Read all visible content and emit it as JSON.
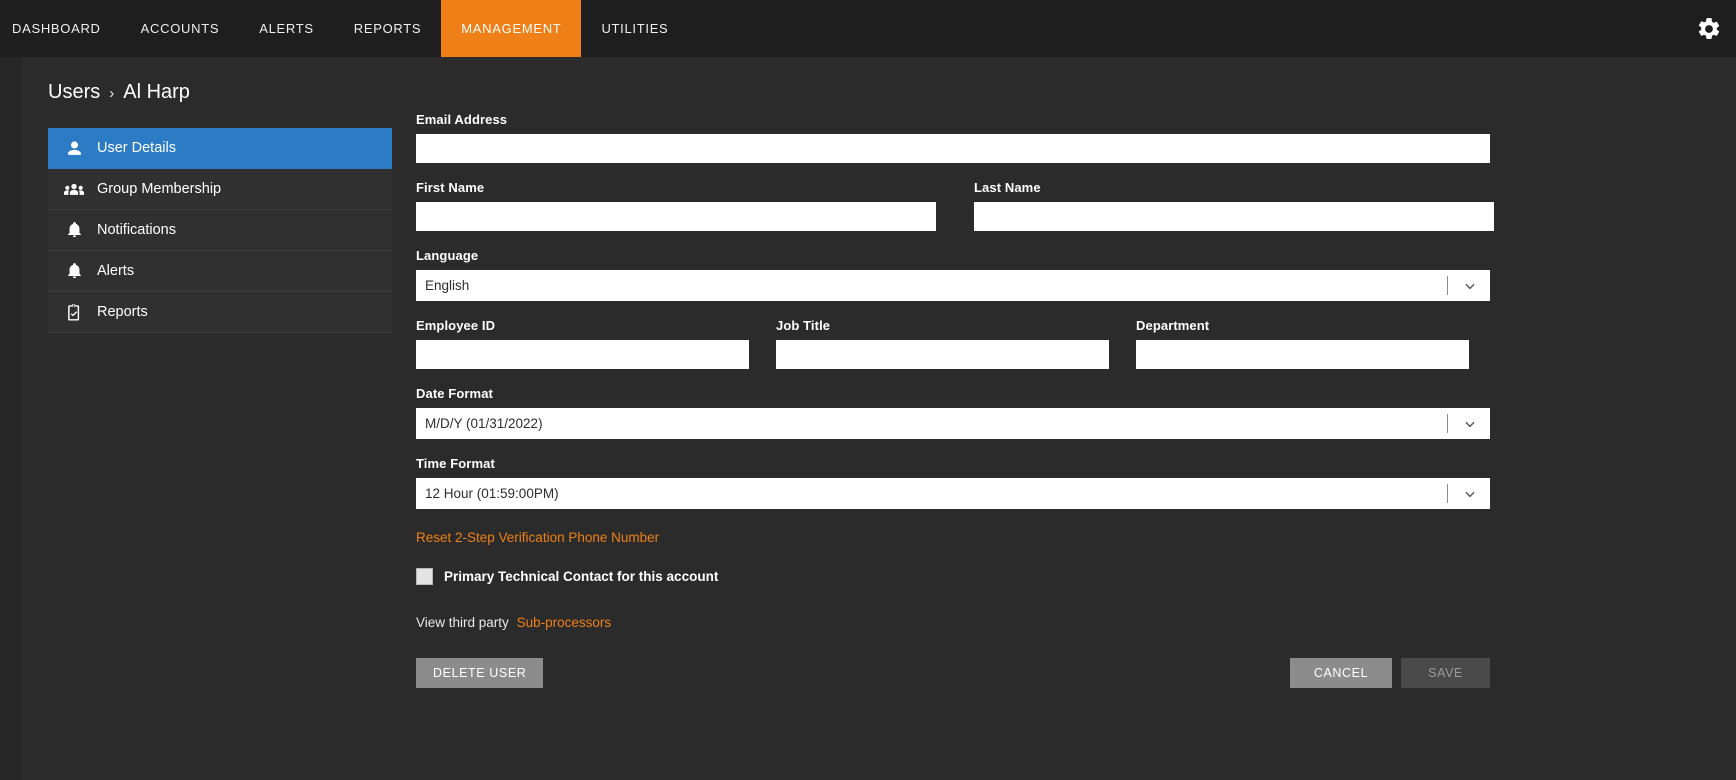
{
  "topnav": {
    "items": [
      {
        "label": "DASHBOARD",
        "active": false
      },
      {
        "label": "ACCOUNTS",
        "active": false
      },
      {
        "label": "ALERTS",
        "active": false
      },
      {
        "label": "REPORTS",
        "active": false
      },
      {
        "label": "MANAGEMENT",
        "active": true
      },
      {
        "label": "UTILITIES",
        "active": false
      }
    ],
    "settings_icon": "gear-icon",
    "accent_color": "#ef8017",
    "background_color": "#1e1e1e"
  },
  "breadcrumb": {
    "root": "Users",
    "separator": "›",
    "current": "Al Harp"
  },
  "sidebar": {
    "items": [
      {
        "label": "User Details",
        "icon": "person-icon",
        "active": true
      },
      {
        "label": "Group Membership",
        "icon": "people-group-icon",
        "active": false
      },
      {
        "label": "Notifications",
        "icon": "bell-icon",
        "active": false
      },
      {
        "label": "Alerts",
        "icon": "bell-icon",
        "active": false
      },
      {
        "label": "Reports",
        "icon": "clipboard-check-icon",
        "active": false
      }
    ],
    "active_color": "#2b7cc4"
  },
  "form": {
    "email": {
      "label": "Email Address",
      "value": "",
      "placeholder": ""
    },
    "first_name": {
      "label": "First Name",
      "value": "",
      "placeholder": ""
    },
    "last_name": {
      "label": "Last Name",
      "value": "",
      "placeholder": ""
    },
    "language": {
      "label": "Language",
      "value": "English"
    },
    "employee_id": {
      "label": "Employee ID",
      "value": "",
      "placeholder": ""
    },
    "job_title": {
      "label": "Job Title",
      "value": "",
      "placeholder": ""
    },
    "department": {
      "label": "Department",
      "value": "",
      "placeholder": ""
    },
    "date_format": {
      "label": "Date Format",
      "value": "M/D/Y (01/31/2022)"
    },
    "time_format": {
      "label": "Time Format",
      "value": "12 Hour (01:59:00PM)"
    },
    "reset_link": "Reset 2-Step Verification Phone Number",
    "primary_contact": {
      "label": "Primary Technical Contact for this account",
      "checked": false
    },
    "subprocessors": {
      "prefix": "View third party",
      "link": "Sub-processors"
    }
  },
  "actions": {
    "delete": "DELETE USER",
    "cancel": "CANCEL",
    "save": "SAVE"
  }
}
